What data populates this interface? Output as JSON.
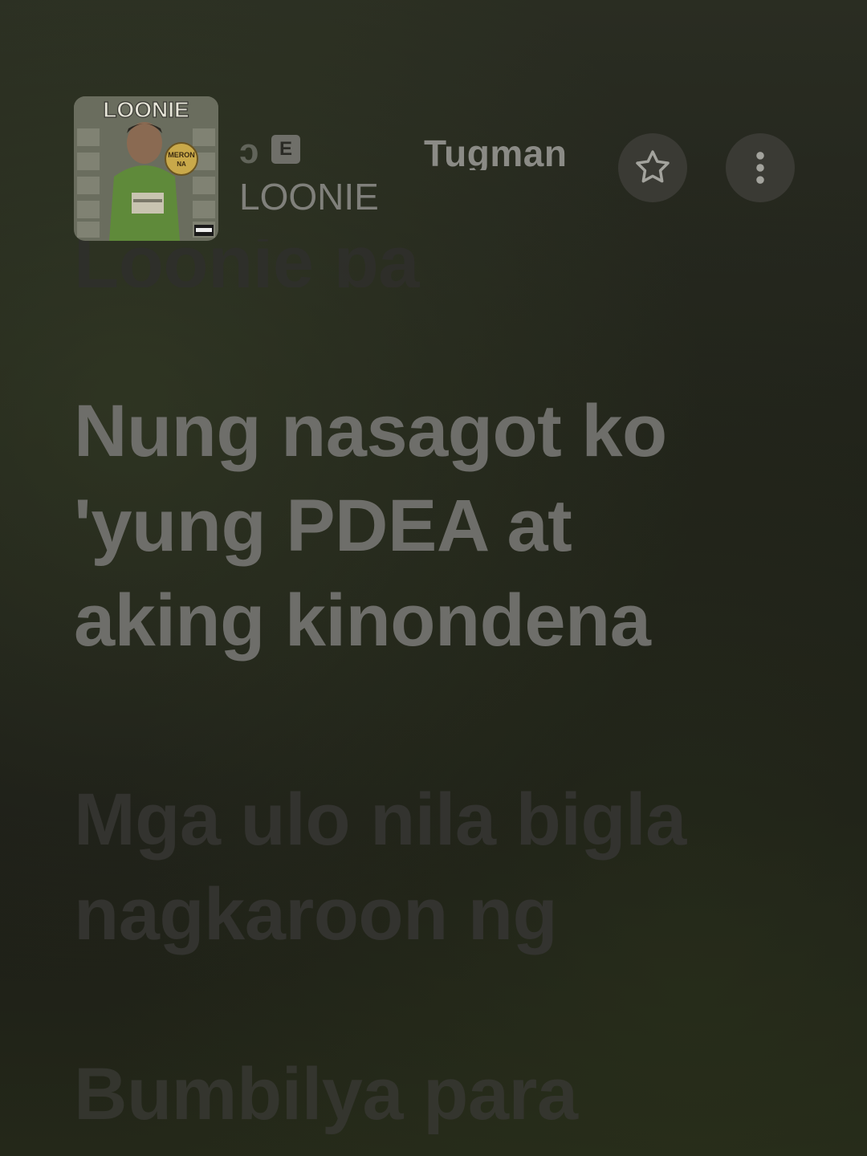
{
  "header": {
    "title_fragment": "ɔ",
    "explicit_badge": "E",
    "track_title": "Tugman",
    "artist": "LOONIE",
    "album_art": {
      "title": "LOONIE",
      "sticker_line1": "MERON",
      "sticker_line2": "NA"
    },
    "favorite_icon": "star-outline-icon",
    "more_icon": "vertical-ellipsis-icon"
  },
  "lyrics": {
    "previous_line": "Loonie pa",
    "active_line": "Nung nasagot ko\n'yung PDEA at\naking kinondena",
    "next_line": "Mga ulo nila bigla\nnagkaroon ng",
    "next_line_2": "Bumbilya para"
  },
  "colors": {
    "active_lyric": "#6e6e6a",
    "inactive_lyric": "#33332f",
    "button_bg": "#3a3a34"
  }
}
